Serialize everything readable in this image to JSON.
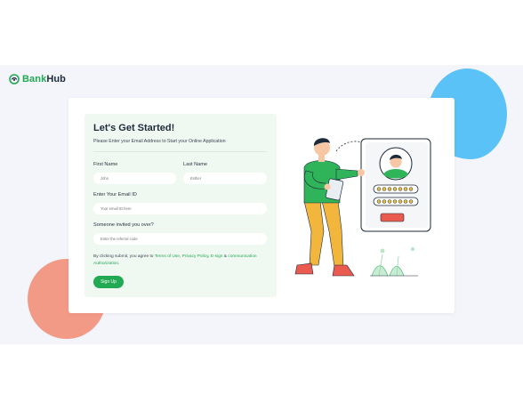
{
  "brand": {
    "part1": "Bank",
    "part2": "Hub"
  },
  "form": {
    "title": "Let's Get Started!",
    "subtitle": "Please Enter your Email Address to Start your Online Application",
    "first_name": {
      "label": "First Name",
      "placeholder": "John"
    },
    "last_name": {
      "label": "Last Name",
      "placeholder": "Esther"
    },
    "email": {
      "label": "Enter Your Email ID",
      "placeholder": "Your email ID here"
    },
    "referral": {
      "label": "Someone invited you over?",
      "placeholder": "Enter the referral code"
    },
    "terms": {
      "prefix": "By clicking submit, you agree to ",
      "link1": "Terms of Use",
      "sep1": ", ",
      "link2": "Privacy Policy",
      "sep2": ", ",
      "link3": "E-sign",
      "sep3": " & ",
      "link4": "communication Authorization",
      "suffix": "."
    },
    "submit_label": "Sign Up"
  },
  "colors": {
    "accent": "#22a953",
    "blob_blue": "#5bc2f7",
    "blob_red": "#f39a86",
    "panel": "#f0f8f2",
    "band": "#f3f5fb"
  },
  "icons": [
    "bankhub-logo-icon",
    "signup-illustration"
  ]
}
